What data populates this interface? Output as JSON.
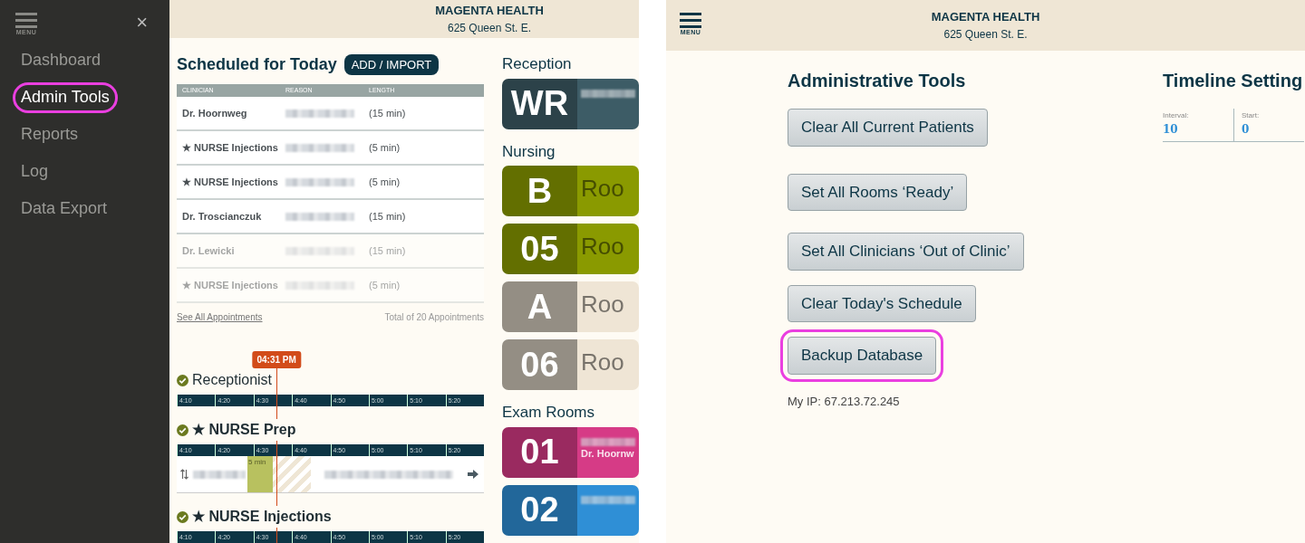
{
  "left_screen": {
    "header": {
      "title": "MAGENTA HEALTH",
      "address": "625 Queen St. E."
    },
    "menu": {
      "label": "MENU",
      "close": "×",
      "items": [
        {
          "label": "Dashboard",
          "selected": false,
          "highlighted": false
        },
        {
          "label": "Admin Tools",
          "selected": true,
          "highlighted": true
        },
        {
          "label": "Reports",
          "selected": false,
          "highlighted": false
        },
        {
          "label": "Log",
          "selected": false,
          "highlighted": false
        },
        {
          "label": "Data Export",
          "selected": false,
          "highlighted": false
        }
      ]
    },
    "schedule": {
      "title": "Scheduled for Today",
      "add_button": "ADD / IMPORT",
      "columns": [
        "CLINICIAN",
        "REASON",
        "LENGTH"
      ],
      "rows": [
        {
          "clinician": "Dr. Hoornweg",
          "length": "(15 min)",
          "faded": false
        },
        {
          "clinician": "★ NURSE Injections",
          "length": "(5 min)",
          "faded": false
        },
        {
          "clinician": "★ NURSE Injections",
          "length": "(5 min)",
          "faded": false
        },
        {
          "clinician": "Dr. Troscianczuk",
          "length": "(15 min)",
          "faded": false
        },
        {
          "clinician": "Dr. Lewicki",
          "length": "(15 min)",
          "faded": true
        },
        {
          "clinician": "★ NURSE Injections",
          "length": "(5 min)",
          "faded": true
        }
      ],
      "see_all": "See All Appointments",
      "total": "Total of 20 Appointments"
    },
    "timeline": {
      "now": "04:31 PM",
      "sections": [
        {
          "title": "Receptionist",
          "ticks": [
            "4:10",
            "4:20",
            "4:30",
            "4:40",
            "4:50",
            "5:00",
            "5:10",
            "5:20"
          ],
          "has_appointment": false
        },
        {
          "title": "★ NURSE Prep",
          "ticks": [
            "4:10",
            "4:20",
            "4:30",
            "4:40",
            "4:50",
            "5:00",
            "5:10",
            "5:20"
          ],
          "has_appointment": true,
          "duration": "5 min"
        },
        {
          "title": "★ NURSE Injections",
          "ticks": [
            "4:10",
            "4:20",
            "4:30",
            "4:40",
            "4:50",
            "5:00",
            "5:10",
            "5:20"
          ],
          "has_appointment": false
        }
      ]
    },
    "rooms": {
      "groups": [
        {
          "title": "Reception",
          "rooms": [
            {
              "code": "WR",
              "color": "#3d5c66",
              "blurred": true
            }
          ]
        },
        {
          "title": "Nursing",
          "rooms": [
            {
              "code": "B",
              "label": "Roo",
              "color": "#8a9a00",
              "blurred": false
            },
            {
              "code": "05",
              "label": "Roo",
              "color": "#8a9a00",
              "blurred": false
            },
            {
              "code": "A",
              "label": "Roo",
              "color": "#efe5d5",
              "blurred": false
            },
            {
              "code": "06",
              "label": "Roo",
              "color": "#efe5d5",
              "blurred": false
            }
          ]
        },
        {
          "title": "Exam Rooms",
          "rooms": [
            {
              "code": "01",
              "sublabel": "Dr. Hoornw",
              "color": "#d63b86",
              "blurred": true
            },
            {
              "code": "02",
              "color": "#2f8fd6",
              "blurred": true
            }
          ]
        }
      ]
    }
  },
  "right_screen": {
    "header": {
      "title": "MAGENTA HEALTH",
      "address": "625 Queen St. E."
    },
    "menu_label": "MENU",
    "admin": {
      "title": "Administrative Tools",
      "buttons": [
        {
          "label": "Clear All Current Patients",
          "highlighted": false
        },
        {
          "label": "Set All Rooms ‘Ready’",
          "highlighted": false
        },
        {
          "label": "Set All Clinicians ‘Out of Clinic’",
          "highlighted": false
        },
        {
          "label": "Clear Today's Schedule",
          "highlighted": false
        },
        {
          "label": "Backup Database",
          "highlighted": true
        }
      ],
      "ip": "My IP: 67.213.72.245"
    },
    "timeline_settings": {
      "title": "Timeline Setting",
      "fields": [
        {
          "label": "Interval:",
          "value": "10"
        },
        {
          "label": "Start:",
          "value": "0"
        }
      ]
    }
  }
}
